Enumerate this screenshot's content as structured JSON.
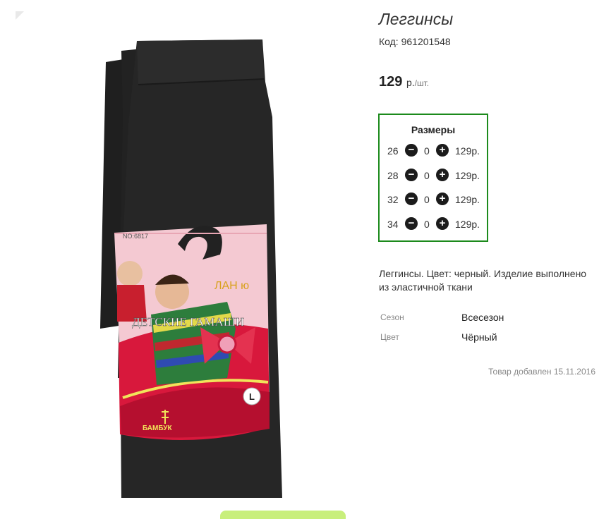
{
  "product": {
    "title": "Леггинсы",
    "code": "Код: 961201548",
    "price": "129",
    "price_unit": "р.",
    "price_per": "/шт.",
    "description": "Леггинсы. Цвет: черный. Изделие выполнено из эластичной ткани",
    "added": "Товар добавлен 15.11.2016"
  },
  "sizes": {
    "title": "Размеры",
    "rows": [
      {
        "size": "26",
        "qty": "0",
        "price": "129р."
      },
      {
        "size": "28",
        "qty": "0",
        "price": "129р."
      },
      {
        "size": "32",
        "qty": "0",
        "price": "129р."
      },
      {
        "size": "34",
        "qty": "0",
        "price": "129р."
      }
    ]
  },
  "attributes": [
    {
      "label": "Сезон",
      "value": "Всесезон"
    },
    {
      "label": "Цвет",
      "value": "Чёрный"
    }
  ],
  "image": {
    "label_no": "NO:6817",
    "brand": "ЛАН ю",
    "label_title": "ДЕТСКИЕ ГАМАШИ",
    "size_badge": "L",
    "material": "БАМБУК"
  },
  "colors": {
    "accent_border": "#1c8a1c",
    "button": "#1b1b1b",
    "promo": "#c8ef7c"
  },
  "icons": {
    "minus": "minus-circle-icon",
    "plus": "plus-circle-icon"
  }
}
